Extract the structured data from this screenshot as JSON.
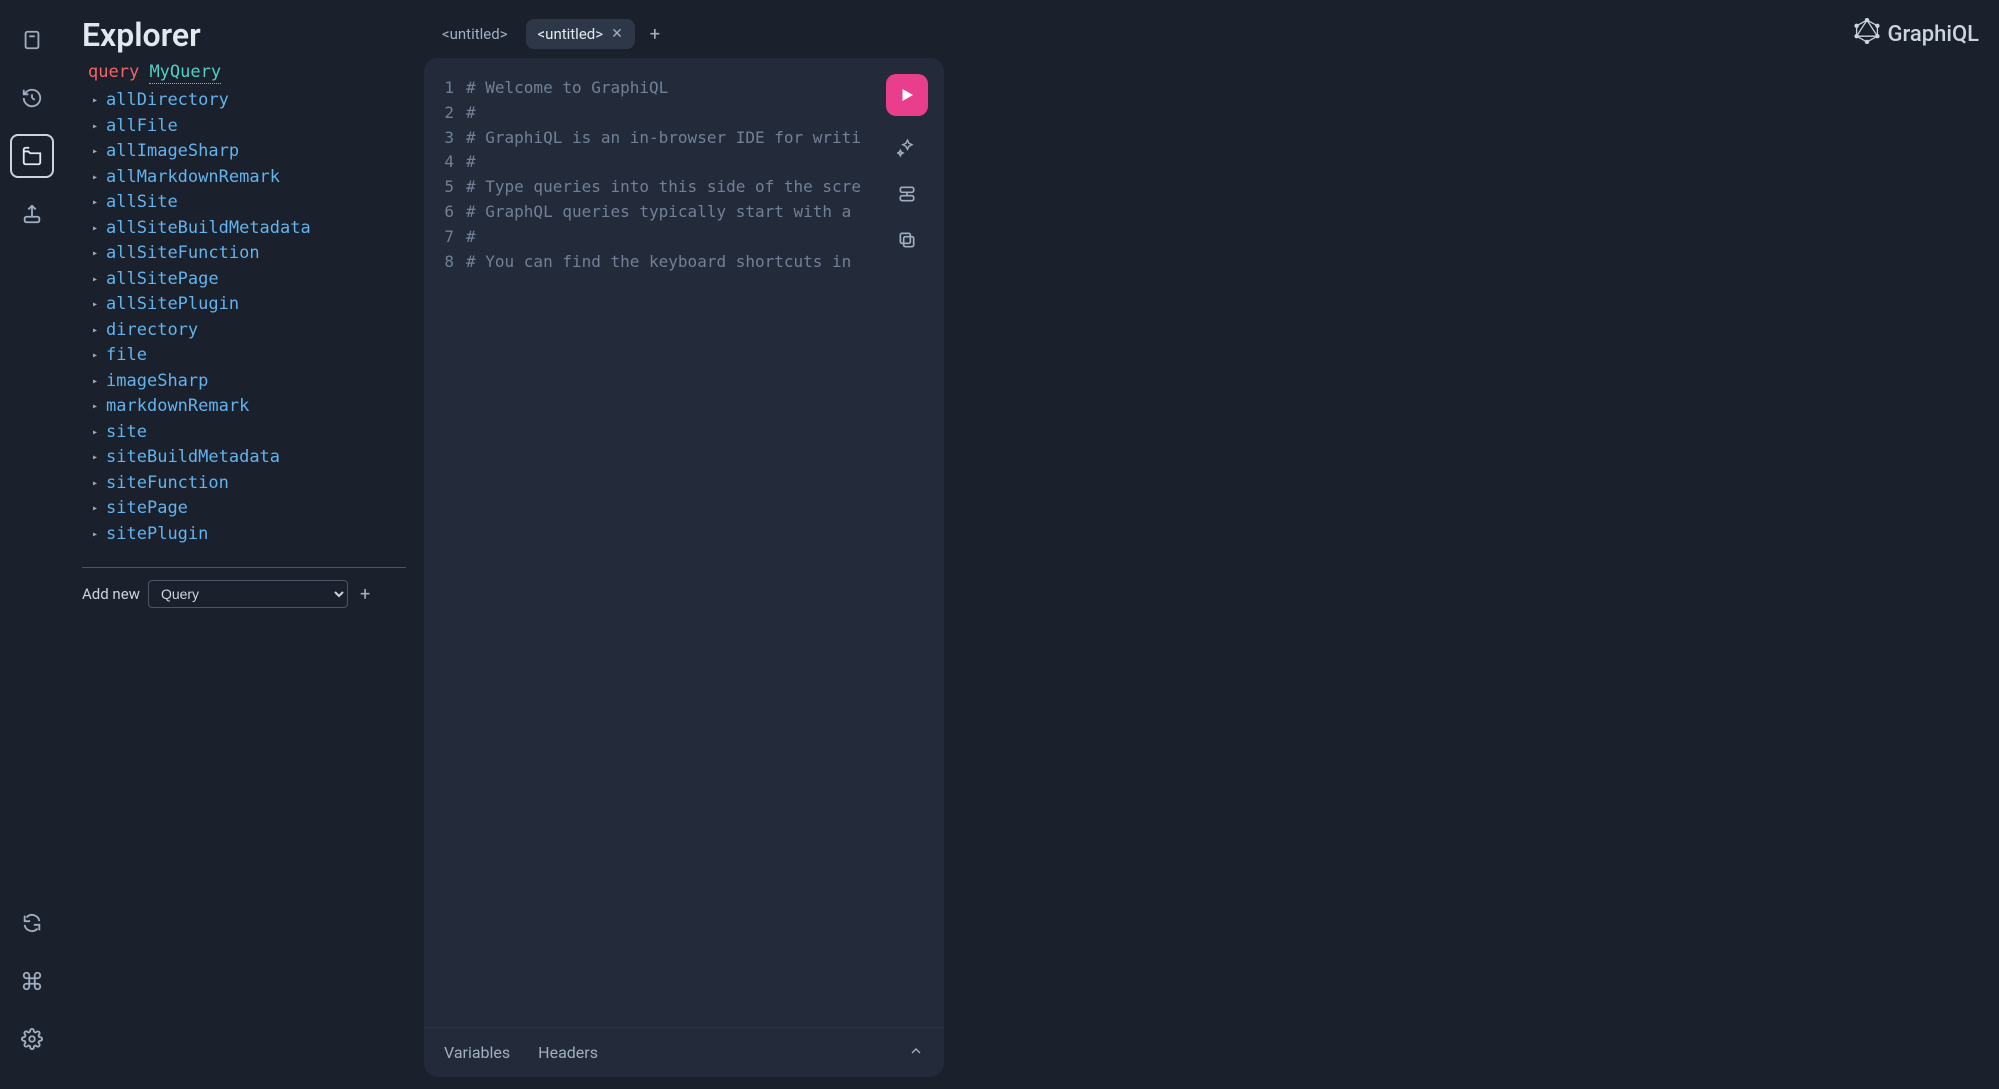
{
  "brand": {
    "name": "GraphiQL"
  },
  "sidebar_icons": [
    {
      "name": "docs-icon"
    },
    {
      "name": "history-icon"
    },
    {
      "name": "explorer-icon"
    },
    {
      "name": "export-icon"
    }
  ],
  "sidebar_bottom_icons": [
    {
      "name": "refresh-icon"
    },
    {
      "name": "shortcuts-icon"
    },
    {
      "name": "settings-icon"
    }
  ],
  "explorer": {
    "title": "Explorer",
    "query_keyword": "query",
    "query_name": "MyQuery",
    "fields": [
      "allDirectory",
      "allFile",
      "allImageSharp",
      "allMarkdownRemark",
      "allSite",
      "allSiteBuildMetadata",
      "allSiteFunction",
      "allSitePage",
      "allSitePlugin",
      "directory",
      "file",
      "imageSharp",
      "markdownRemark",
      "site",
      "siteBuildMetadata",
      "siteFunction",
      "sitePage",
      "sitePlugin"
    ],
    "add_new_label": "Add new",
    "add_new_selected": "Query"
  },
  "tabs": [
    {
      "label": "<untitled>",
      "active": false
    },
    {
      "label": "<untitled>",
      "active": true
    }
  ],
  "editor": {
    "lines": [
      "# Welcome to GraphiQL",
      "#",
      "# GraphiQL is an in-browser IDE for writi",
      "#",
      "# Type queries into this side of the scre",
      "# GraphQL queries typically start with a",
      "#",
      "# You can find the keyboard shortcuts in"
    ],
    "footer": {
      "variables": "Variables",
      "headers": "Headers"
    }
  }
}
